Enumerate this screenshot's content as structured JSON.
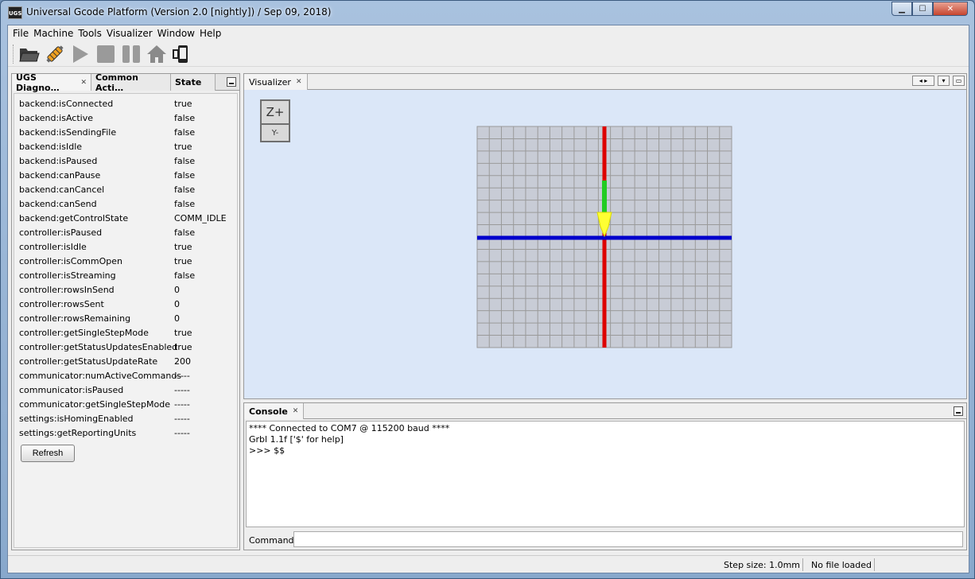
{
  "window": {
    "app_icon_text": "UGS",
    "title": "Universal Gcode Platform (Version 2.0 [nightly])  / Sep 09, 2018)"
  },
  "menu": [
    "File",
    "Machine",
    "Tools",
    "Visualizer",
    "Window",
    "Help"
  ],
  "toolbar": {
    "buttons": [
      "open-folder-icon",
      "connect-plug-icon",
      "play-icon",
      "stop-icon",
      "pause-icon",
      "home-icon",
      "device-icon"
    ]
  },
  "left_panel": {
    "tabs": [
      {
        "label": "UGS Diagno…",
        "active": true
      },
      {
        "label": "Common Acti…",
        "active": false
      },
      {
        "label": "State",
        "active": false
      }
    ],
    "rows": [
      {
        "key": "backend:isConnected",
        "value": "true"
      },
      {
        "key": "backend:isActive",
        "value": "false"
      },
      {
        "key": "backend:isSendingFile",
        "value": "false"
      },
      {
        "key": "backend:isIdle",
        "value": "true"
      },
      {
        "key": "backend:isPaused",
        "value": "false"
      },
      {
        "key": "backend:canPause",
        "value": "false"
      },
      {
        "key": "backend:canCancel",
        "value": "false"
      },
      {
        "key": "backend:canSend",
        "value": "false"
      },
      {
        "key": "backend:getControlState",
        "value": "COMM_IDLE"
      },
      {
        "key": "controller:isPaused",
        "value": "false"
      },
      {
        "key": "controller:isIdle",
        "value": "true"
      },
      {
        "key": "controller:isCommOpen",
        "value": "true"
      },
      {
        "key": "controller:isStreaming",
        "value": "false"
      },
      {
        "key": "controller:rowsInSend",
        "value": "0"
      },
      {
        "key": "controller:rowsSent",
        "value": "0"
      },
      {
        "key": "controller:rowsRemaining",
        "value": "0"
      },
      {
        "key": "controller:getSingleStepMode",
        "value": "true"
      },
      {
        "key": "controller:getStatusUpdatesEnabled",
        "value": "true"
      },
      {
        "key": "controller:getStatusUpdateRate",
        "value": "200"
      },
      {
        "key": "communicator:numActiveCommands",
        "value": "-----"
      },
      {
        "key": "communicator:isPaused",
        "value": "-----"
      },
      {
        "key": "communicator:getSingleStepMode",
        "value": "-----"
      },
      {
        "key": "settings:isHomingEnabled",
        "value": "-----"
      },
      {
        "key": "settings:getReportingUnits",
        "value": "-----"
      }
    ],
    "refresh_label": "Refresh"
  },
  "visualizer": {
    "tab_label": "Visualizer",
    "cube_top": "Z+",
    "cube_front": "Y-",
    "colors": {
      "x_axis": "#0000cc",
      "y_axis": "#dd0000",
      "z_axis": "#22cc22",
      "tool": "#ffff33",
      "grid_bg": "#c8ccd6",
      "grid_line": "#9a9a9a"
    }
  },
  "console": {
    "tab_label": "Console",
    "lines": [
      "**** Connected to COM7 @ 115200 baud ****",
      "Grbl 1.1f ['$' for help]",
      ">>> $$"
    ],
    "command_label": "Command:",
    "command_value": ""
  },
  "status": {
    "step_size": "Step size: 1.0mm",
    "file": "No file loaded"
  }
}
